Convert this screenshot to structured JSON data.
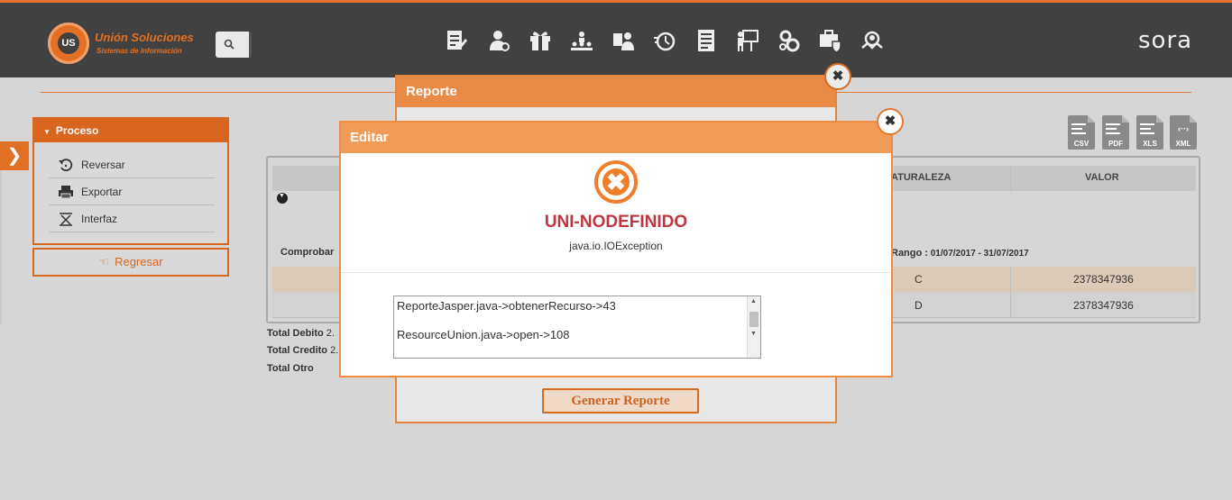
{
  "header": {
    "logo_badge": "US",
    "logo_title": "Unión Soluciones",
    "logo_subtitle": "Sistemas de Información",
    "brand": "sora",
    "nav_icons": [
      "edit-document-icon",
      "user-settings-icon",
      "gift-icon",
      "org-chart-icon",
      "user-card-icon",
      "timer-icon",
      "report-sheet-icon",
      "presentation-icon",
      "gears-icon",
      "secure-briefcase-icon",
      "badge-icon"
    ]
  },
  "sidebar": {
    "panel_title": "Proceso",
    "items": [
      {
        "label": "Reversar",
        "icon": "undo-icon"
      },
      {
        "label": "Exportar",
        "icon": "printer-icon"
      },
      {
        "label": "Interfaz",
        "icon": "interface-icon"
      }
    ],
    "back_label": "Regresar"
  },
  "exports": [
    "CSV",
    "PDF",
    "XLS",
    "XML"
  ],
  "table": {
    "col_naturaleza": "ATURALEZA",
    "col_valor": "VALOR",
    "comprobante_label": "Comprobar",
    "rango_label": "Rango :",
    "rango_value": "01/07/2017 - 31/07/2017",
    "rows": [
      {
        "naturaleza": "C",
        "valor": "2378347936"
      },
      {
        "naturaleza": "D",
        "valor": "2378347936"
      }
    ],
    "total_debito": "Total Debito",
    "total_debito_val": "2.",
    "total_credito": "Total Credito",
    "total_credito_val": "2.",
    "total_otro": "Total Otro"
  },
  "reporte_dialog": {
    "title": "Reporte",
    "generate_label": "Generar Reporte"
  },
  "editar_dialog": {
    "title": "Editar",
    "error_code": "UNI-NODEFINIDO",
    "error_message": "java.io.IOException",
    "trace": [
      "ReporteJasper.java->obtenerRecurso->43",
      "ResourceUnion.java->open->108"
    ]
  },
  "colors": {
    "accent": "#e37023",
    "header_bg": "#414141",
    "error_red": "#c0353f"
  }
}
